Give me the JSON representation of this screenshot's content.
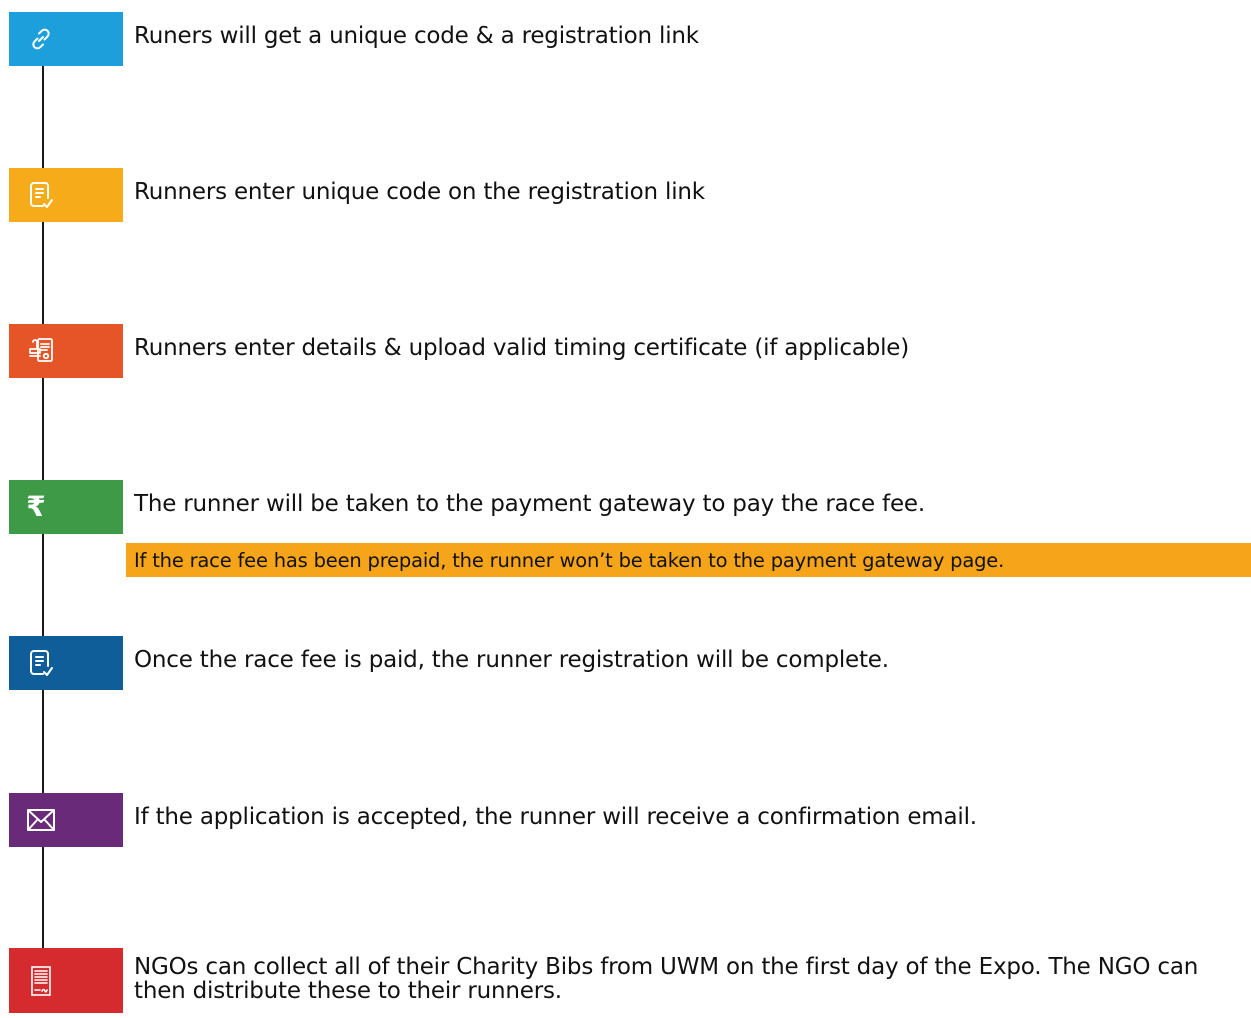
{
  "steps": [
    {
      "text": "Runers will get a unique code & a registration link",
      "color": "#1d9fdb",
      "icon": "link-icon"
    },
    {
      "text": "Runners enter unique code on the registration link",
      "color": "#f6ac1a",
      "icon": "document-check-icon"
    },
    {
      "text": "Runners enter details & upload valid timing certificate (if applicable)",
      "color": "#e55527",
      "icon": "certificate-stamp-icon"
    },
    {
      "text": "The runner will be taken to the payment gateway to pay the race fee.",
      "color": "#3f9a47",
      "icon": "rupee-icon",
      "icon_glyph": "₹"
    },
    {
      "text": "Once the race fee is paid, the runner registration will be complete.",
      "color": "#0f5e9a",
      "icon": "document-check-icon"
    },
    {
      "text": "If the application is accepted, the runner will receive a confirmation email.",
      "color": "#6a2a7a",
      "icon": "envelope-icon"
    },
    {
      "text": "NGOs can collect all of their Charity Bibs from UWM on the first day of the Expo. The NGO can then distribute these to their runners.",
      "color": "#d52b2e",
      "icon": "signed-document-icon"
    }
  ],
  "note": {
    "text": "If the race fee has been prepaid, the runner won’t be taken to the payment gateway page.",
    "color": "#f6a51a"
  }
}
